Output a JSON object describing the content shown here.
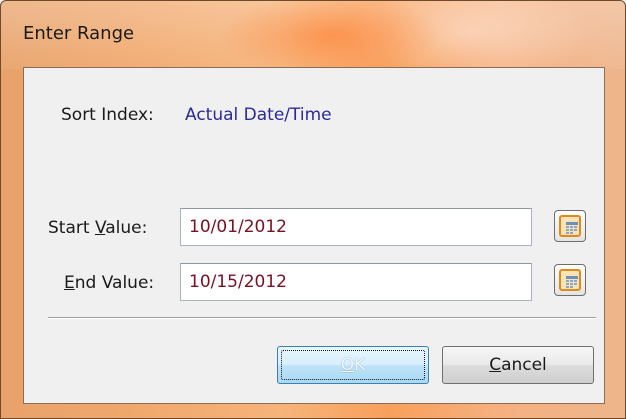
{
  "window": {
    "title": "Enter Range"
  },
  "sort": {
    "label": "Sort Index:",
    "value": "Actual Date/Time"
  },
  "start": {
    "label_prefix": "Start ",
    "label_accel": "V",
    "label_suffix": "alue:",
    "value": "10/01/2012"
  },
  "end": {
    "label_accel": "E",
    "label_suffix": "nd Value:",
    "value": "10/15/2012"
  },
  "buttons": {
    "ok_accel": "O",
    "ok_suffix": "K",
    "cancel_accel": "C",
    "cancel_suffix": "ancel"
  },
  "icons": {
    "calendar": "calendar-icon"
  }
}
